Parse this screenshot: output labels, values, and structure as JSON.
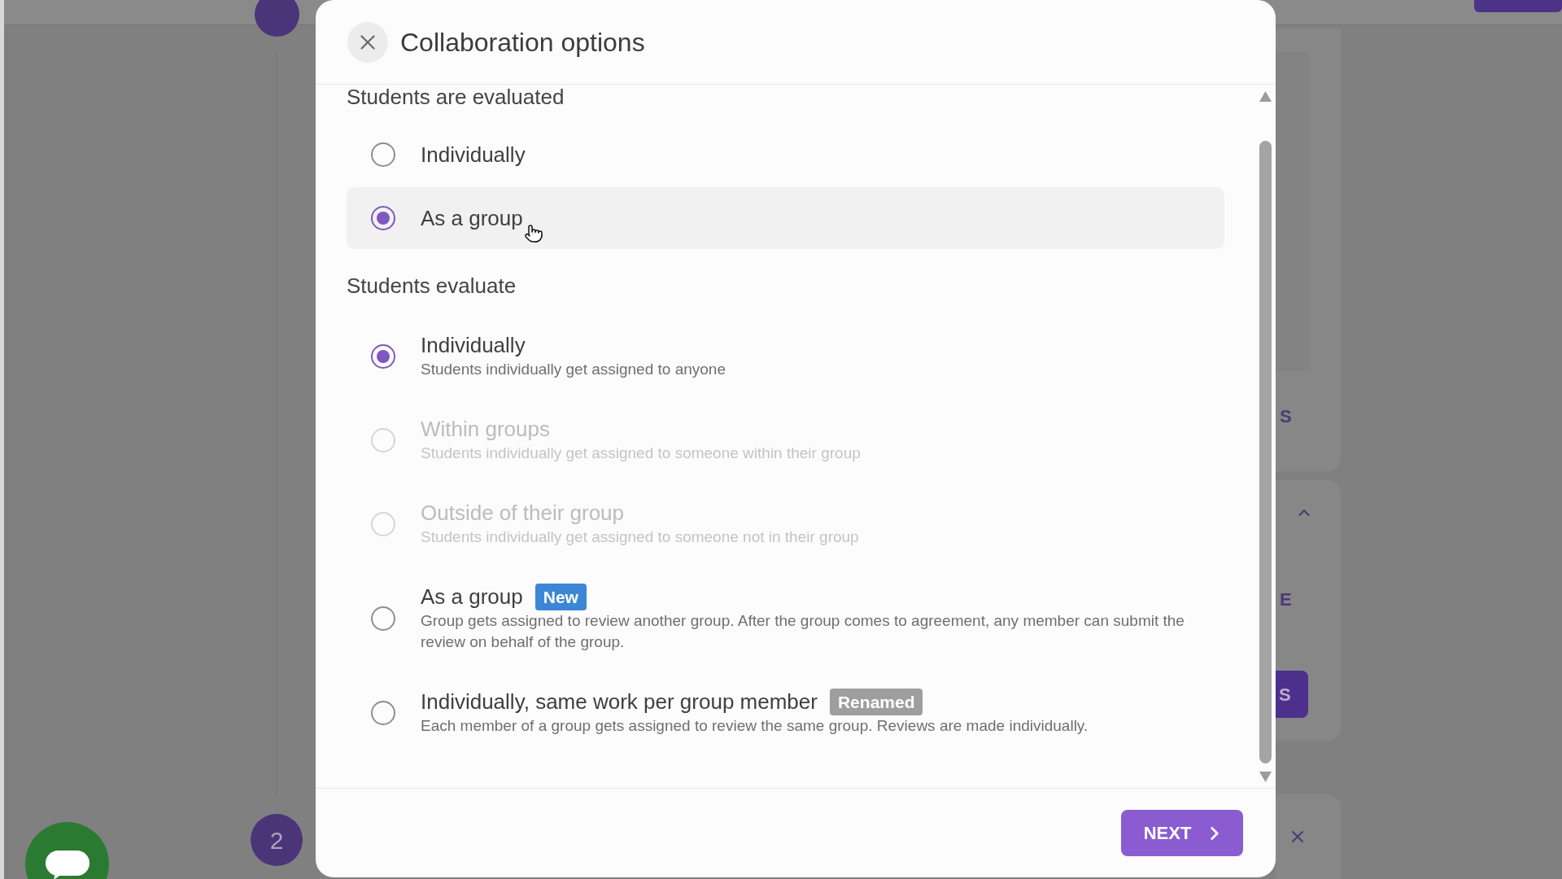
{
  "page": {
    "step_number": "2",
    "side_panel": {
      "text_1": "S",
      "text_2": "E",
      "button": "S"
    }
  },
  "dialog": {
    "title": "Collaboration options",
    "sections": [
      {
        "heading": "Students are evaluated",
        "options": [
          {
            "label": "Individually",
            "selected": false,
            "hovered": false
          },
          {
            "label": "As a group",
            "selected": true,
            "hovered": true
          }
        ]
      },
      {
        "heading": "Students evaluate",
        "options": [
          {
            "label": "Individually",
            "description": "Students individually get assigned to anyone",
            "selected": true,
            "disabled": false
          },
          {
            "label": "Within groups",
            "description": "Students individually get assigned to someone within their group",
            "selected": false,
            "disabled": true
          },
          {
            "label": "Outside of their group",
            "description": "Students individually get assigned to someone not in their group",
            "selected": false,
            "disabled": true
          },
          {
            "label": "As a group",
            "description": "Group gets assigned to review another group. After the group comes to agreement, any member can submit the review on behalf of the group.",
            "selected": false,
            "disabled": false,
            "badge": {
              "text": "New",
              "color": "#3b87d6"
            }
          },
          {
            "label": "Individually, same work per group member",
            "description": "Each member of a group gets assigned to review the same group. Reviews are made individually.",
            "selected": false,
            "disabled": false,
            "badge": {
              "text": "Renamed",
              "color": "#9e9e9e"
            }
          }
        ]
      }
    ],
    "next_button": "NEXT"
  }
}
